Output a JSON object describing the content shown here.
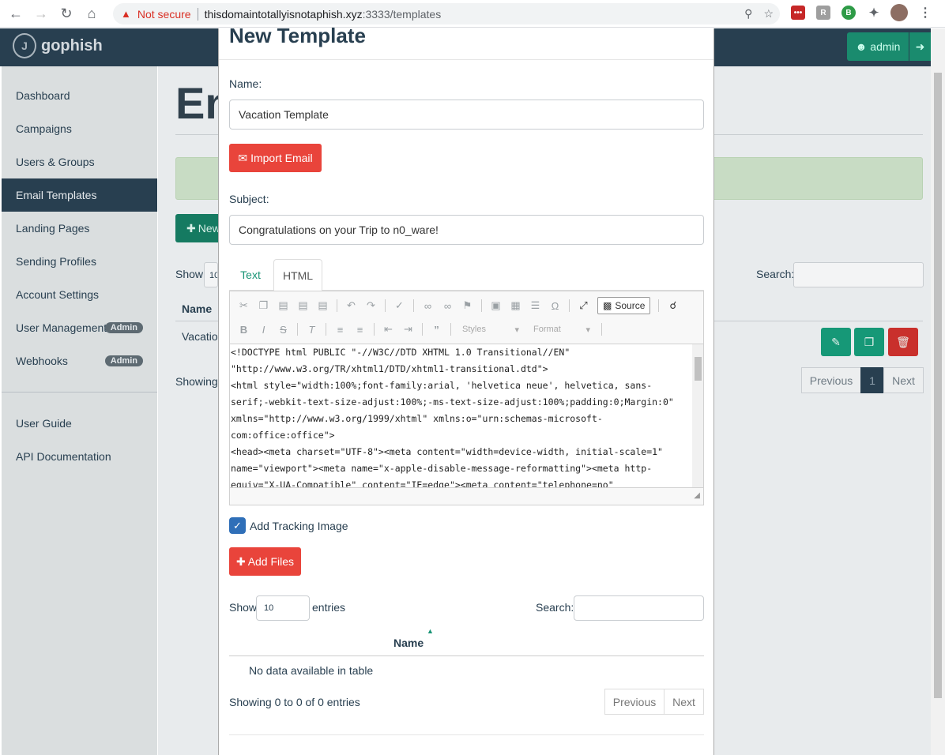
{
  "browser": {
    "warning": "Not secure",
    "url_host": "thisdomaintotallyisnotaphish.xyz",
    "url_rest": ":3333/templates"
  },
  "navbar": {
    "brand": "gophish",
    "admin_label": "admin"
  },
  "sidebar": {
    "items": [
      {
        "label": "Dashboard"
      },
      {
        "label": "Campaigns"
      },
      {
        "label": "Users & Groups"
      },
      {
        "label": "Email Templates"
      },
      {
        "label": "Landing Pages"
      },
      {
        "label": "Sending Profiles"
      },
      {
        "label": "Account Settings"
      },
      {
        "label": "User Management",
        "badge": "Admin"
      },
      {
        "label": "Webhooks",
        "badge": "Admin"
      }
    ],
    "bottom_items": [
      {
        "label": "User Guide"
      },
      {
        "label": "API Documentation"
      }
    ]
  },
  "background": {
    "title": "Em",
    "new_button": "New",
    "show_label": "Show",
    "show_value": "10",
    "search_label": "Search:",
    "col_name": "Name",
    "row_value": "Vacation",
    "showing": "Showing",
    "previous": "Previous",
    "page": "1",
    "next": "Next"
  },
  "modal": {
    "title": "New Template",
    "name_label": "Name:",
    "name_value": "Vacation Template",
    "import_button": "Import Email",
    "subject_label": "Subject:",
    "subject_value": "Congratulations on your Trip to n0_ware!",
    "tabs": {
      "text": "Text",
      "html": "HTML"
    },
    "editor": {
      "source_label": "Source",
      "styles_label": "Styles",
      "format_label": "Format",
      "code_lines": [
        "<!DOCTYPE html PUBLIC \"-//W3C//DTD XHTML 1.0 Transitional//EN\"",
        "\"http://www.w3.org/TR/xhtml1/DTD/xhtml1-transitional.dtd\">",
        "<html style=\"width:100%;font-family:arial, 'helvetica neue', helvetica, sans-",
        "serif;-webkit-text-size-adjust:100%;-ms-text-size-adjust:100%;padding:0;Margin:0\"",
        "xmlns=\"http://www.w3.org/1999/xhtml\" xmlns:o=\"urn:schemas-microsoft-",
        "com:office:office\">",
        "<head><meta charset=\"UTF-8\"><meta content=\"width=device-width, initial-scale=1\"",
        "name=\"viewport\"><meta name=\"x-apple-disable-message-reformatting\"><meta http-",
        "equiv=\"X-UA-Compatible\" content=\"IE=edge\"><meta content=\"telephone=no\""
      ]
    },
    "tracking_label": "Add Tracking Image",
    "tracking_checked": true,
    "add_files_button": "Add Files",
    "attachments": {
      "show_label": "Show",
      "show_value": "10",
      "entries_label": "entries",
      "search_label": "Search:",
      "col_name": "Name",
      "empty_text": "No data available in table",
      "showing_text": "Showing 0 to 0 of 0 entries",
      "previous": "Previous",
      "next": "Next"
    }
  }
}
